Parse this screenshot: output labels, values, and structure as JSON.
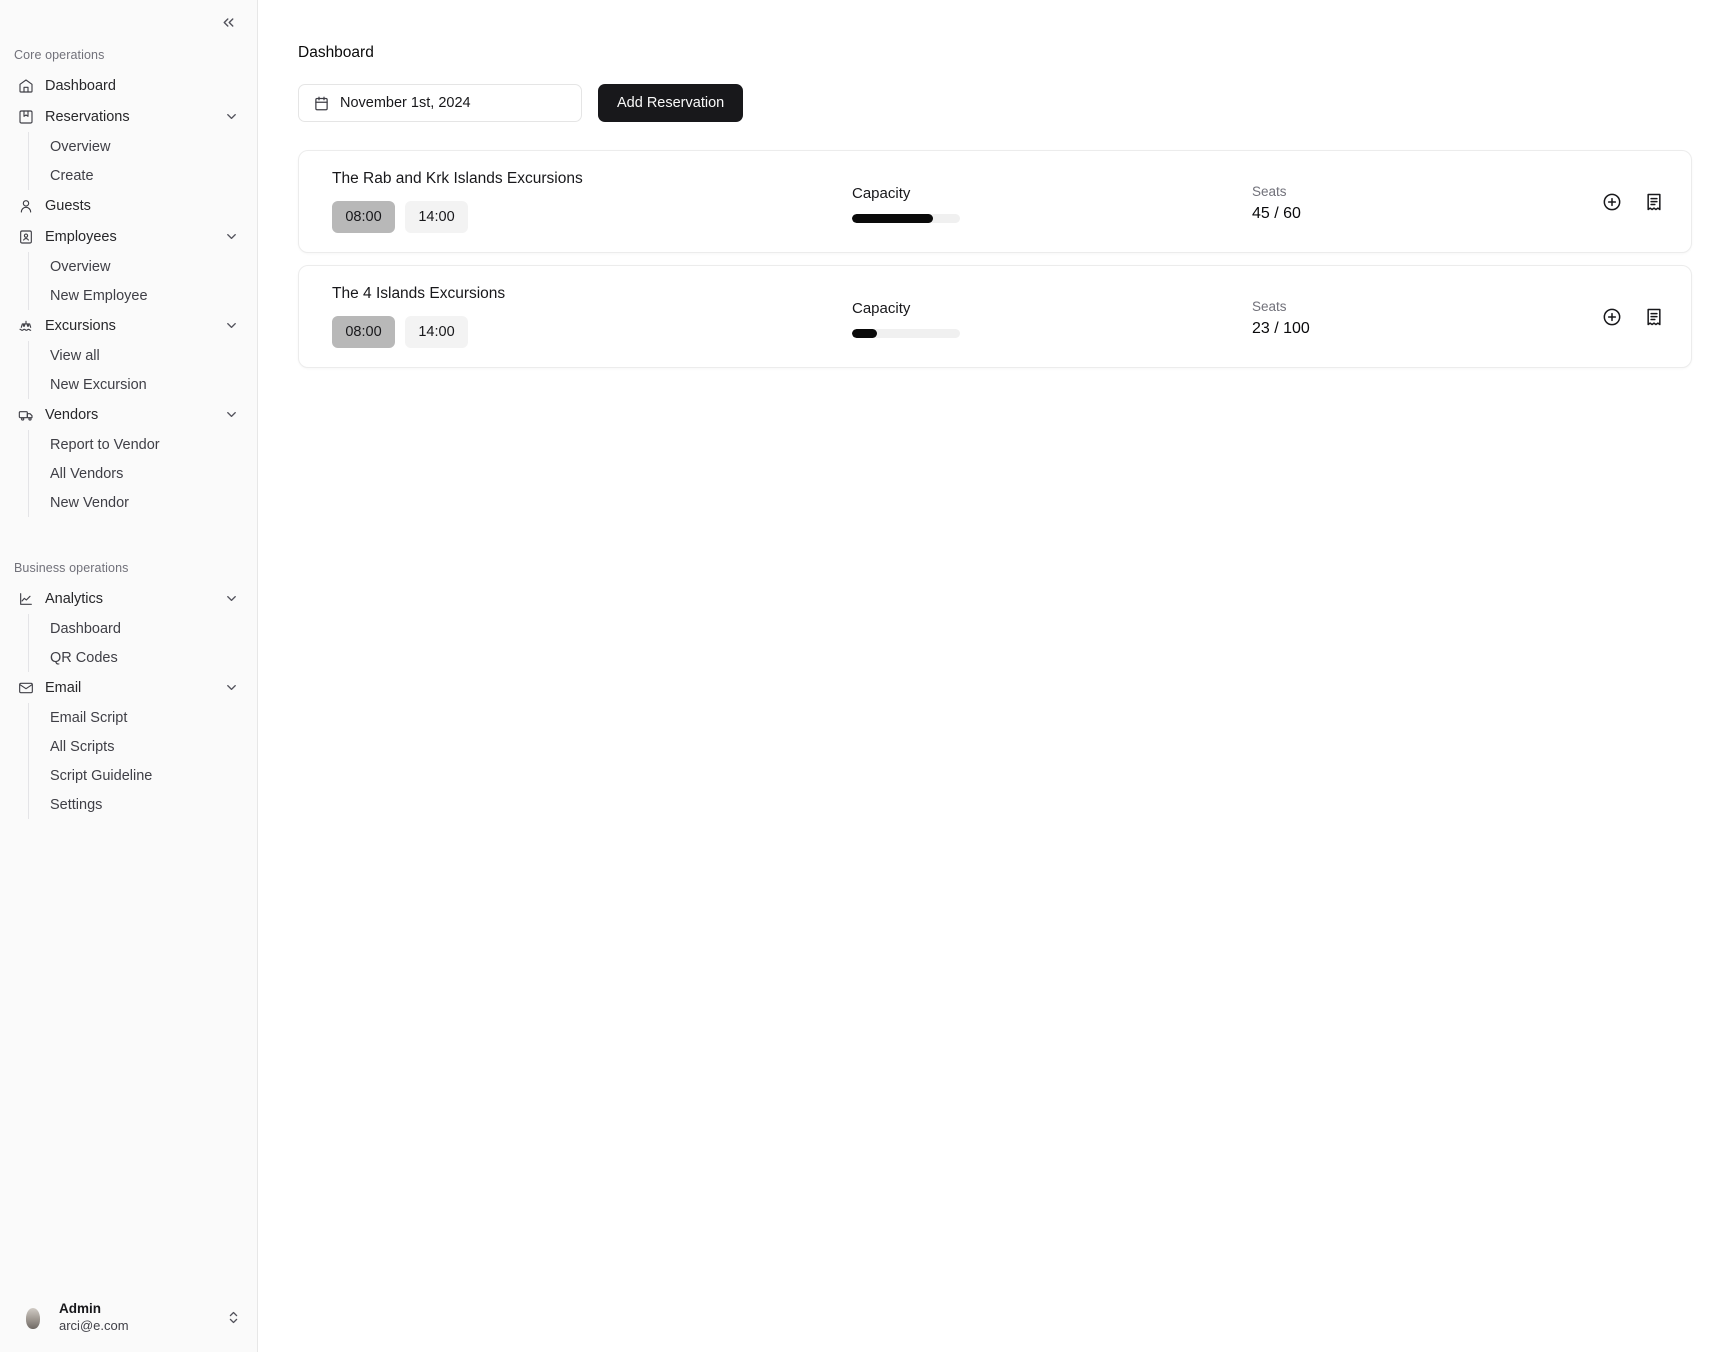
{
  "sidebar": {
    "collapse_icon": "chevrons-left-icon",
    "groups": [
      {
        "label": "Core operations",
        "items": [
          {
            "label": "Dashboard",
            "icon": "home-icon",
            "expandable": false,
            "children": []
          },
          {
            "label": "Reservations",
            "icon": "bookmark-icon",
            "expandable": true,
            "children": [
              "Overview",
              "Create"
            ]
          },
          {
            "label": "Guests",
            "icon": "user-icon",
            "expandable": false,
            "children": []
          },
          {
            "label": "Employees",
            "icon": "contact-card-icon",
            "expandable": true,
            "children": [
              "Overview",
              "New Employee"
            ]
          },
          {
            "label": "Excursions",
            "icon": "boat-icon",
            "expandable": true,
            "children": [
              "View all",
              "New Excursion"
            ]
          },
          {
            "label": "Vendors",
            "icon": "truck-icon",
            "expandable": true,
            "children": [
              "Report to Vendor",
              "All Vendors",
              "New Vendor"
            ]
          }
        ]
      },
      {
        "label": "Business operations",
        "items": [
          {
            "label": "Analytics",
            "icon": "line-chart-icon",
            "expandable": true,
            "children": [
              "Dashboard",
              "QR Codes"
            ]
          },
          {
            "label": "Email",
            "icon": "mail-icon",
            "expandable": true,
            "children": [
              "Email Script",
              "All Scripts",
              "Script Guideline",
              "Settings"
            ]
          }
        ]
      }
    ],
    "user": {
      "name": "Admin",
      "email": "arci@e.com",
      "avatar_icon": "user-avatar-image",
      "switcher_icon": "chevrons-up-down-icon"
    }
  },
  "main": {
    "page_title": "Dashboard",
    "toolbar": {
      "date_value": "November 1st, 2024",
      "calendar_icon": "calendar-icon",
      "add_reservation_label": "Add Reservation"
    },
    "cards": [
      {
        "title": "The Rab and Krk Islands Excursions",
        "times": [
          {
            "label": "08:00",
            "selected": true
          },
          {
            "label": "14:00",
            "selected": false
          }
        ],
        "capacity_label": "Capacity",
        "capacity_percent": 75,
        "seats_label": "Seats",
        "seats_value": "45 / 60",
        "seats_taken": 45,
        "seats_total": 60,
        "actions": [
          {
            "icon": "circle-plus-icon",
            "name": "add-booking-button"
          },
          {
            "icon": "receipt-icon",
            "name": "view-details-button"
          }
        ]
      },
      {
        "title": "The 4 Islands Excursions",
        "times": [
          {
            "label": "08:00",
            "selected": true
          },
          {
            "label": "14:00",
            "selected": false
          }
        ],
        "capacity_label": "Capacity",
        "capacity_percent": 23,
        "seats_label": "Seats",
        "seats_value": "23 / 100",
        "seats_taken": 23,
        "seats_total": 100,
        "actions": [
          {
            "icon": "circle-plus-icon",
            "name": "add-booking-button"
          },
          {
            "icon": "receipt-icon",
            "name": "view-details-button"
          }
        ]
      }
    ]
  },
  "colors": {
    "accent": "#18181b",
    "sidebar_bg": "#fafafa",
    "chip_active": "#b8b8b8",
    "chip_idle": "#f3f3f3",
    "progress_fill": "#0a0a0a",
    "progress_track": "#f0f0f0"
  }
}
